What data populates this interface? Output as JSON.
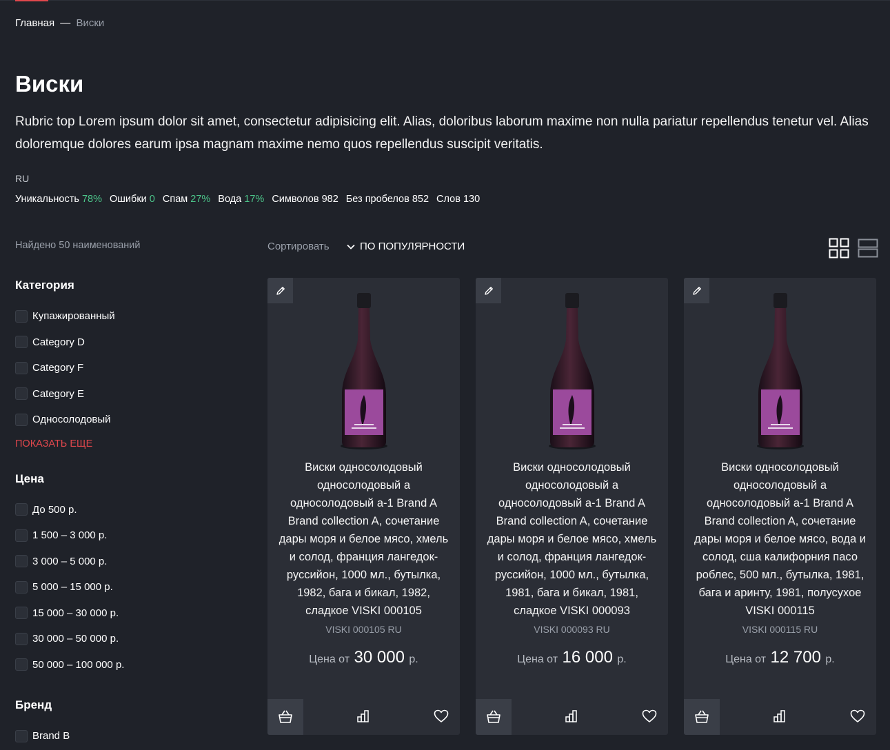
{
  "breadcrumb": {
    "home": "Главная",
    "separator": "—",
    "current": "Виски"
  },
  "page": {
    "title": "Виски",
    "description": "Rubric top Lorem ipsum dolor sit amet, consectetur adipisicing elit. Alias, doloribus laborum maxime non nulla pariatur repellendus tenetur vel. Alias doloremque dolores earum ipsa magnam maxime nemo quos repellendus suscipit veritatis."
  },
  "seo": {
    "lang": "RU",
    "stats": [
      {
        "label": "Уникальность",
        "value": "78%",
        "highlight": true
      },
      {
        "label": "Ошибки",
        "value": "0",
        "highlight": true
      },
      {
        "label": "Спам",
        "value": "27%",
        "highlight": true
      },
      {
        "label": "Вода",
        "value": "17%",
        "highlight": true
      },
      {
        "label": "Символов",
        "value": "982",
        "highlight": false
      },
      {
        "label": "Без пробелов",
        "value": "852",
        "highlight": false
      },
      {
        "label": "Слов",
        "value": "130",
        "highlight": false
      }
    ]
  },
  "toolbar": {
    "found": "Найдено 50 наименований",
    "sort_label": "Сортировать",
    "sort_value": "ПО ПОПУЛЯРНОСТИ"
  },
  "filters": {
    "category": {
      "title": "Категория",
      "items": [
        "Купажированный",
        "Category D",
        "Category F",
        "Category E",
        "Односолодовый"
      ],
      "show_more": "ПОКАЗАТЬ ЕЩЕ"
    },
    "price": {
      "title": "Цена",
      "items": [
        "До 500 р.",
        "1 500 – 3 000 р.",
        "3 000 – 5 000 р.",
        "5 000 – 15 000 р.",
        "15 000 – 30 000 р.",
        "30 000 – 50 000 р.",
        "50 000 – 100 000 р."
      ]
    },
    "brand": {
      "title": "Бренд",
      "items": [
        "Brand B"
      ]
    }
  },
  "products": [
    {
      "title": "Виски односолодовый односолодовый а односолодовый а-1 Brand A Brand collection A, сочетание дары моря и белое мясо, хмель и солод, франция лангедок-руссийон, 1000 мл., бутылка, 1982, бага и бикал, 1982, сладкое VISKI 000105",
      "sku": "VISKI 000105 RU",
      "price_prefix": "Цена от",
      "price": "30 000",
      "currency": "р."
    },
    {
      "title": "Виски односолодовый односолодовый а односолодовый а-1 Brand A Brand collection A, сочетание дары моря и белое мясо, хмель и солод, франция лангедок-руссийон, 1000 мл., бутылка, 1981, бага и бикал, 1981, сладкое VISKI 000093",
      "sku": "VISKI 000093 RU",
      "price_prefix": "Цена от",
      "price": "16 000",
      "currency": "р."
    },
    {
      "title": "Виски односолодовый односолодовый а односолодовый а-1 Brand A Brand collection A, сочетание дары моря и белое мясо, вода и солод, сша калифорния пасо роблес, 500 мл., бутылка, 1981, бага и аринту, 1981, полусухое VISKI 000115",
      "sku": "VISKI 000115 RU",
      "price_prefix": "Цена от",
      "price": "12 700",
      "currency": "р."
    }
  ],
  "colors": {
    "accent": "#e0474c",
    "positive": "#4cc58a",
    "background": "#1f2229",
    "card": "#2b2e36"
  },
  "icons": [
    "pencil-icon",
    "basket-icon",
    "bar-chart-icon",
    "heart-icon",
    "grid-view-icon",
    "list-view-icon",
    "chevron-down-icon"
  ]
}
